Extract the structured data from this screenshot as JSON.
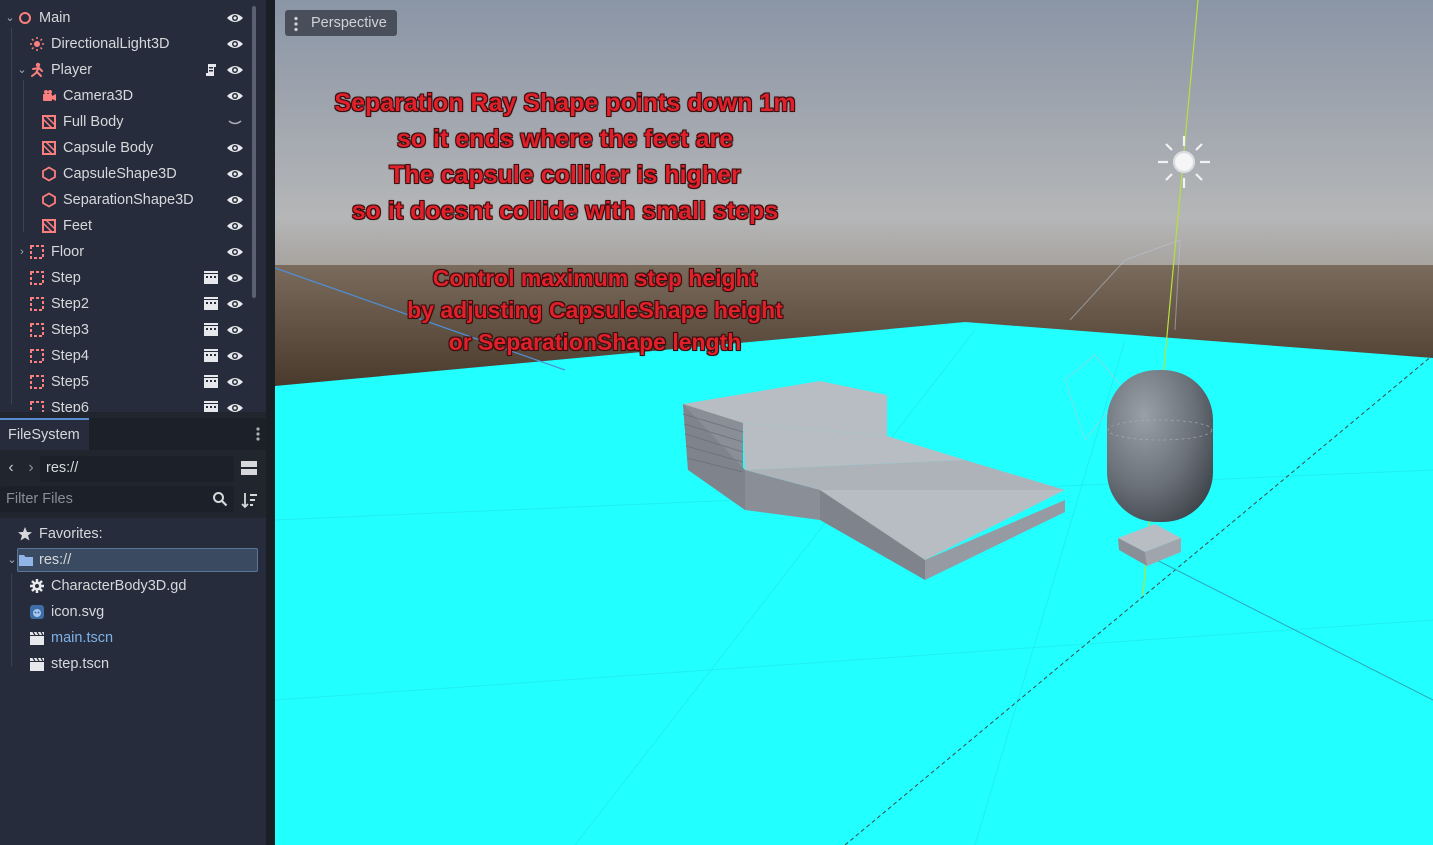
{
  "scene_tree": {
    "nodes": [
      {
        "label": "Main",
        "icon": "node3d-icon",
        "depth": 0,
        "expanded": true,
        "visible": true
      },
      {
        "label": "DirectionalLight3D",
        "icon": "directional-light-icon",
        "depth": 1,
        "visible": true
      },
      {
        "label": "Player",
        "icon": "character-body-icon",
        "depth": 1,
        "expanded": true,
        "has_script": true,
        "visible": true
      },
      {
        "label": "Camera3D",
        "icon": "camera-icon",
        "depth": 2,
        "visible": true
      },
      {
        "label": "Full Body",
        "icon": "mesh-instance-icon",
        "depth": 2,
        "visible": false
      },
      {
        "label": "Capsule Body",
        "icon": "mesh-instance-icon",
        "depth": 2,
        "visible": true
      },
      {
        "label": "CapsuleShape3D",
        "icon": "collision-shape-icon",
        "depth": 2,
        "visible": true
      },
      {
        "label": "SeparationShape3D",
        "icon": "collision-shape-icon",
        "depth": 2,
        "visible": true
      },
      {
        "label": "Feet",
        "icon": "mesh-instance-icon",
        "depth": 2,
        "visible": true
      },
      {
        "label": "Floor",
        "icon": "static-body-icon",
        "depth": 1,
        "expanded": false,
        "visible": true
      },
      {
        "label": "Step",
        "icon": "static-body-icon",
        "depth": 1,
        "instanced": true,
        "visible": true
      },
      {
        "label": "Step2",
        "icon": "static-body-icon",
        "depth": 1,
        "instanced": true,
        "visible": true
      },
      {
        "label": "Step3",
        "icon": "static-body-icon",
        "depth": 1,
        "instanced": true,
        "visible": true
      },
      {
        "label": "Step4",
        "icon": "static-body-icon",
        "depth": 1,
        "instanced": true,
        "visible": true
      },
      {
        "label": "Step5",
        "icon": "static-body-icon",
        "depth": 1,
        "instanced": true,
        "visible": true
      },
      {
        "label": "Step6",
        "icon": "static-body-icon",
        "depth": 1,
        "instanced": true,
        "visible": true
      }
    ]
  },
  "filesystem": {
    "tab_label": "FileSystem",
    "path": "res://",
    "filter_placeholder": "Filter Files",
    "favorites_label": "Favorites:",
    "root_label": "res://",
    "files": [
      {
        "label": "CharacterBody3D.gd",
        "icon": "script-gear-icon",
        "color": "#d6d8db"
      },
      {
        "label": "icon.svg",
        "icon": "godot-image-icon",
        "color": "#d6d8db"
      },
      {
        "label": "main.tscn",
        "icon": "scene-clapper-icon",
        "color": "#7eb2e8"
      },
      {
        "label": "step.tscn",
        "icon": "scene-clapper-icon",
        "color": "#d6d8db"
      }
    ]
  },
  "viewport": {
    "view_mode": "Perspective",
    "note_lines_1": [
      "Separation Ray Shape points down 1m",
      "so it ends where the feet are",
      "The capsule collider is higher",
      "so it doesnt collide with small steps"
    ],
    "note_lines_2": [
      "Control maximum step height",
      "by adjusting CapsuleShape height",
      "or SeparationShape length"
    ]
  },
  "colors": {
    "floor": "#22ffff",
    "note_text": "#e0202a",
    "sky_top": "#8a95a5",
    "accent": "#5a8bcf"
  }
}
